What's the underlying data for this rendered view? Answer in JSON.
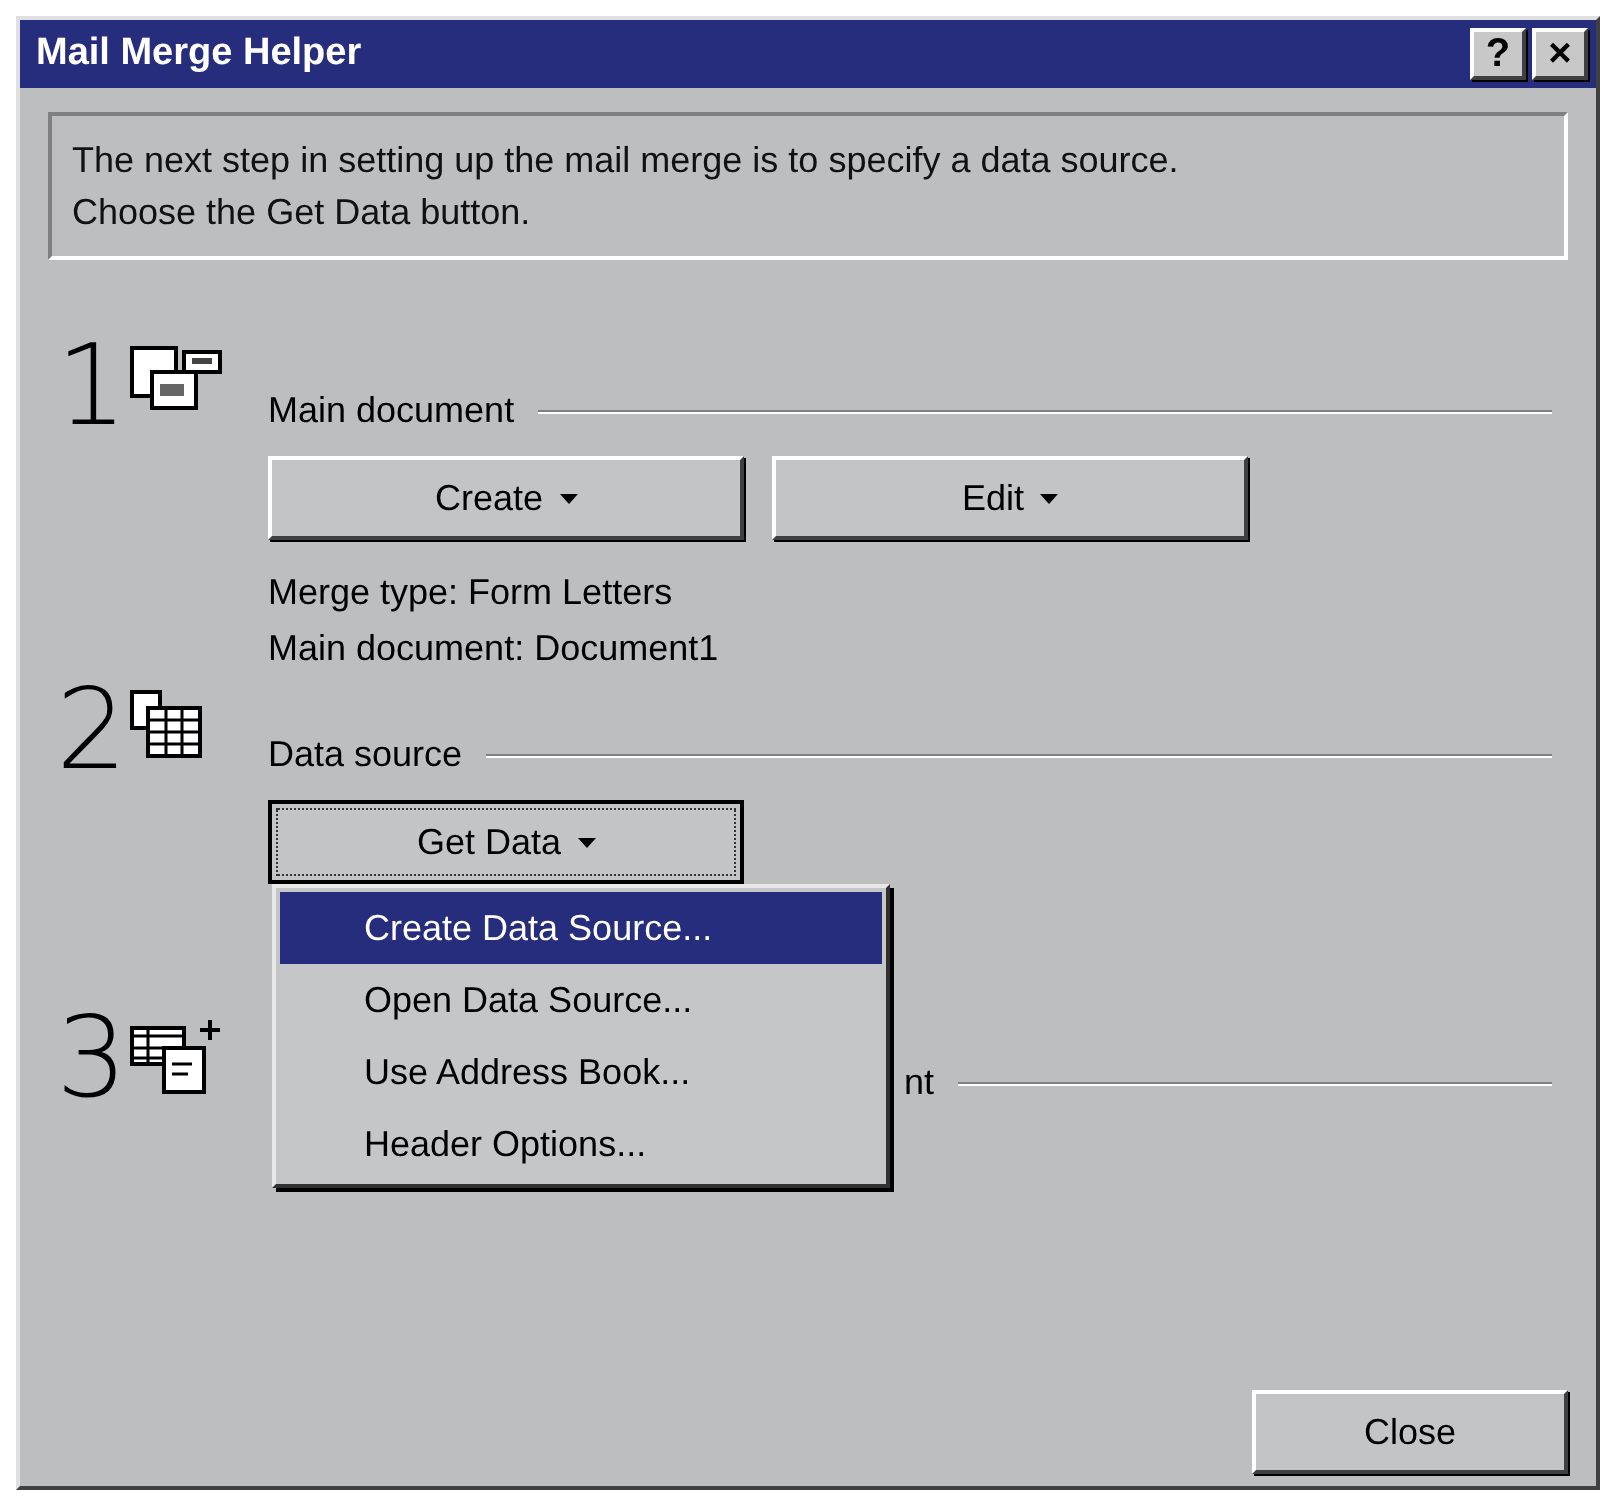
{
  "window": {
    "title": "Mail Merge Helper",
    "title_buttons": [
      "?",
      "×"
    ]
  },
  "instructions": "The next step in setting up the mail merge is to specify a data source.\nChoose the Get Data button.",
  "steps": [
    {
      "number": "1",
      "kind": "main",
      "label": "Main document",
      "buttons": [
        {
          "label": "Create",
          "focused": false
        },
        {
          "label": "Edit",
          "focused": false
        }
      ],
      "details": [
        "Merge type: Form Letters",
        "Main document: Document1"
      ]
    },
    {
      "number": "2",
      "kind": "data",
      "label": "Data source",
      "buttons": [
        {
          "label": "Get Data",
          "focused": true
        }
      ]
    },
    {
      "number": "3",
      "kind": "merge",
      "label": "nt"
    }
  ],
  "menu": {
    "items": [
      {
        "label": "Create Data Source...",
        "selected": true
      },
      {
        "label": "Open Data Source...",
        "selected": false
      },
      {
        "label": "Use Address Book...",
        "selected": false
      },
      {
        "label": "Header Options...",
        "selected": false
      }
    ]
  },
  "close_button": "Close"
}
